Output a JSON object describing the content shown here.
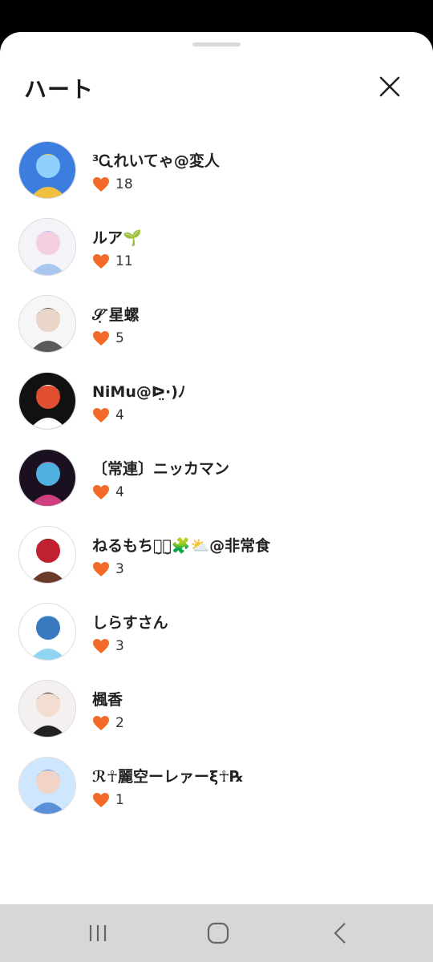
{
  "sheet": {
    "title": "ハート",
    "close_icon": "close-icon"
  },
  "likers": [
    {
      "name": "³Ꮹれいてゃ@変人",
      "count": "18",
      "avatar_colors": [
        "#3c7de0",
        "#f0c040",
        "#8fd0ff"
      ]
    },
    {
      "name": "ルア🌱",
      "count": "11",
      "avatar_colors": [
        "#f4f4f8",
        "#a8c6ee",
        "#f4cfe0"
      ]
    },
    {
      "name": "𝒮̣ᐝ星螺",
      "count": "5",
      "avatar_colors": [
        "#f6f6f6",
        "#5a5a5a",
        "#e9d6c8"
      ]
    },
    {
      "name": "NiMu@ᐅ̤·)ﾉ",
      "count": "4",
      "avatar_colors": [
        "#111111",
        "#ffffff",
        "#e05030"
      ]
    },
    {
      "name": "〔常連〕ニッカマン",
      "count": "4",
      "avatar_colors": [
        "#1a1020",
        "#d04080",
        "#50b0e0"
      ]
    },
    {
      "name": "ねるもちｏ̮ｏ̮🧩⛅@非常食",
      "count": "3",
      "avatar_colors": [
        "#ffffff",
        "#6a3a2a",
        "#c02030"
      ]
    },
    {
      "name": "しらすさん",
      "count": "3",
      "avatar_colors": [
        "#ffffff",
        "#8fd4f0",
        "#3a78c0"
      ]
    },
    {
      "name": "楓香",
      "count": "2",
      "avatar_colors": [
        "#f4f0f0",
        "#222222",
        "#f3ddd0"
      ]
    },
    {
      "name": "ℛ☥麗空ーレァーξ☥℞",
      "count": "1",
      "avatar_colors": [
        "#cfe6ff",
        "#5a90d8",
        "#f2d4c6"
      ]
    }
  ],
  "heart_color": "#f26b2a",
  "navbar": {
    "recents_icon": "recents-icon",
    "home_icon": "home-icon",
    "back_icon": "back-icon"
  }
}
